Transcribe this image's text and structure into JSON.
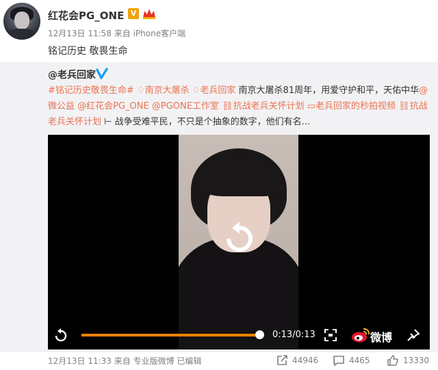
{
  "post": {
    "username": "红花会PG_ONE",
    "v_badge": "V",
    "meta": "12月13日 11:58 来自 iPhone客户端",
    "text": "铭记历史 敬畏生命"
  },
  "repost": {
    "author": "@老兵回家",
    "text_parts": [
      {
        "text": "#铭记历史敬畏生命#",
        "tag": true
      },
      {
        "text": " ",
        "tag": false
      },
      {
        "text": "南京大屠杀",
        "tag": true
      },
      {
        "text": " ",
        "tag": false
      },
      {
        "text": "老兵回家",
        "tag": true
      },
      {
        "text": " 南京大屠杀81周年，用爱守护和平，天佑中华",
        "tag": false
      },
      {
        "text": "@微公益 @红花会PG_ONE @PGONE工作室",
        "tag": true
      },
      {
        "text": " ",
        "tag": false
      },
      {
        "text": "抗战老兵关怀计划",
        "tag": true
      },
      {
        "text": " ",
        "tag": false
      },
      {
        "text": "老兵回家的秒拍视频",
        "tag": true
      },
      {
        "text": " ",
        "tag": false
      },
      {
        "text": "抗战老兵关怀计划",
        "tag": true
      },
      {
        "text": " 战争受难平民，不只是个抽象的数字，他们有名...",
        "tag": false
      }
    ],
    "video": {
      "time": "0:13/0:13",
      "progress": 1.0,
      "brand": "微博"
    },
    "meta": "12月13日 11:33 来自 专业版微博  已编辑",
    "reposts": "44946",
    "comments": "4465",
    "likes": "13330"
  },
  "colors": {
    "accent": "#eb7350",
    "progress": "#ff8200",
    "verified": "#f0a30a",
    "blue_v": "#1da1f2"
  }
}
